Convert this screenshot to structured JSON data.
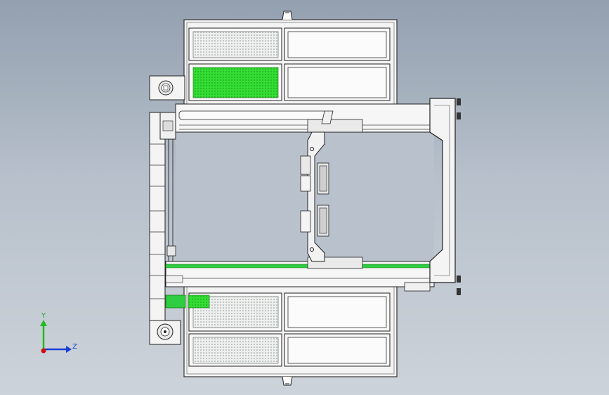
{
  "triad": {
    "y_label": "Y",
    "z_label": "Z"
  },
  "colors": {
    "background_top": "#93a0b0",
    "background_bottom": "#cdd3da",
    "panel_green": "#33dd33",
    "rail_green": "#2ecc40",
    "axis_y": "#22bb22",
    "axis_z": "#1a3fd6",
    "axis_x": "#d01010"
  }
}
